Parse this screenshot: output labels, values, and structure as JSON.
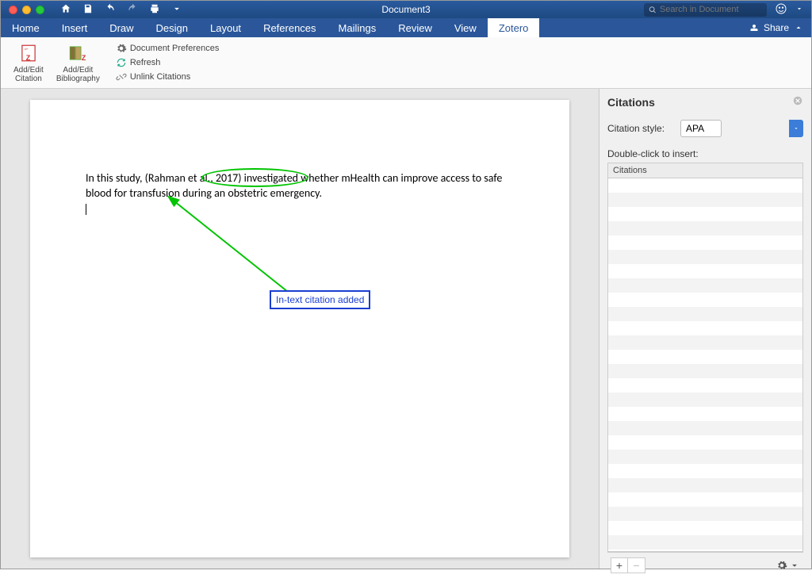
{
  "title": "Document3",
  "search_placeholder": "Search in Document",
  "menu": {
    "items": [
      "Home",
      "Insert",
      "Draw",
      "Design",
      "Layout",
      "References",
      "Mailings",
      "Review",
      "View",
      "Zotero"
    ],
    "active": "Zotero",
    "share": "Share"
  },
  "ribbon": {
    "add_edit_citation": "Add/Edit\nCitation",
    "add_edit_biblio": "Add/Edit\nBibliography",
    "doc_prefs": "Document Preferences",
    "refresh": "Refresh",
    "unlink": "Unlink Citations"
  },
  "document": {
    "text_before": "In this study, ",
    "citation": "(Rahman et al., 2017)",
    "text_after": " investigated whether mHealth can improve access to safe blood for transfusion during an obstetric emergency."
  },
  "callout": "In-text citation added",
  "panel": {
    "title": "Citations",
    "style_label": "Citation style:",
    "style_value": "APA",
    "hint": "Double-click to insert:",
    "col_head": "Citations"
  }
}
